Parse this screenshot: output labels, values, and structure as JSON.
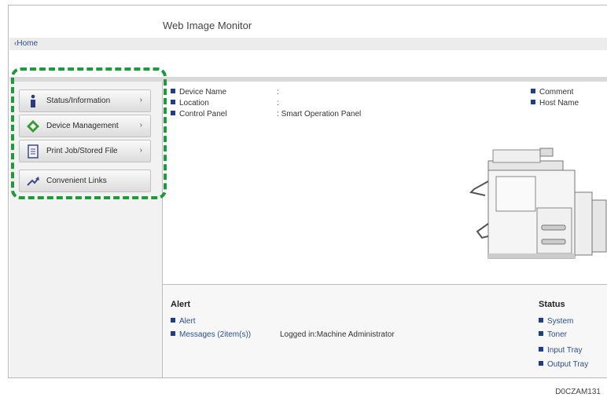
{
  "header": {
    "title": "Web Image Monitor",
    "home": "Home",
    "home_arrow": "‹"
  },
  "sidebar": {
    "items": [
      {
        "label": "Status/Information",
        "icon": "info-icon",
        "arrow": "›"
      },
      {
        "label": "Device Management",
        "icon": "device-management-icon",
        "arrow": "›"
      },
      {
        "label": "Print Job/Stored File",
        "icon": "document-icon",
        "arrow": "›"
      },
      {
        "label": "Convenient Links",
        "icon": "link-icon"
      }
    ]
  },
  "device_info": {
    "left": [
      {
        "label": "Device Name",
        "sep": ":",
        "value": ""
      },
      {
        "label": "Location",
        "sep": ":",
        "value": ""
      },
      {
        "label": "Control Panel",
        "sep": ":",
        "value": "Smart Operation Panel"
      }
    ],
    "right": [
      {
        "label": "Comment"
      },
      {
        "label": "Host Name"
      }
    ]
  },
  "alert": {
    "heading": "Alert",
    "items": [
      "Alert",
      "Messages (2item(s))"
    ],
    "logged_in": "Logged in:Machine Administrator"
  },
  "status": {
    "heading": "Status",
    "items": [
      "System",
      "Toner",
      "Input Tray",
      "Output Tray"
    ]
  },
  "figure_code": "D0CZAM131",
  "colors": {
    "accent": "#1e9a3c",
    "link": "#2b4f8c",
    "bullet": "#1f3d8a"
  }
}
